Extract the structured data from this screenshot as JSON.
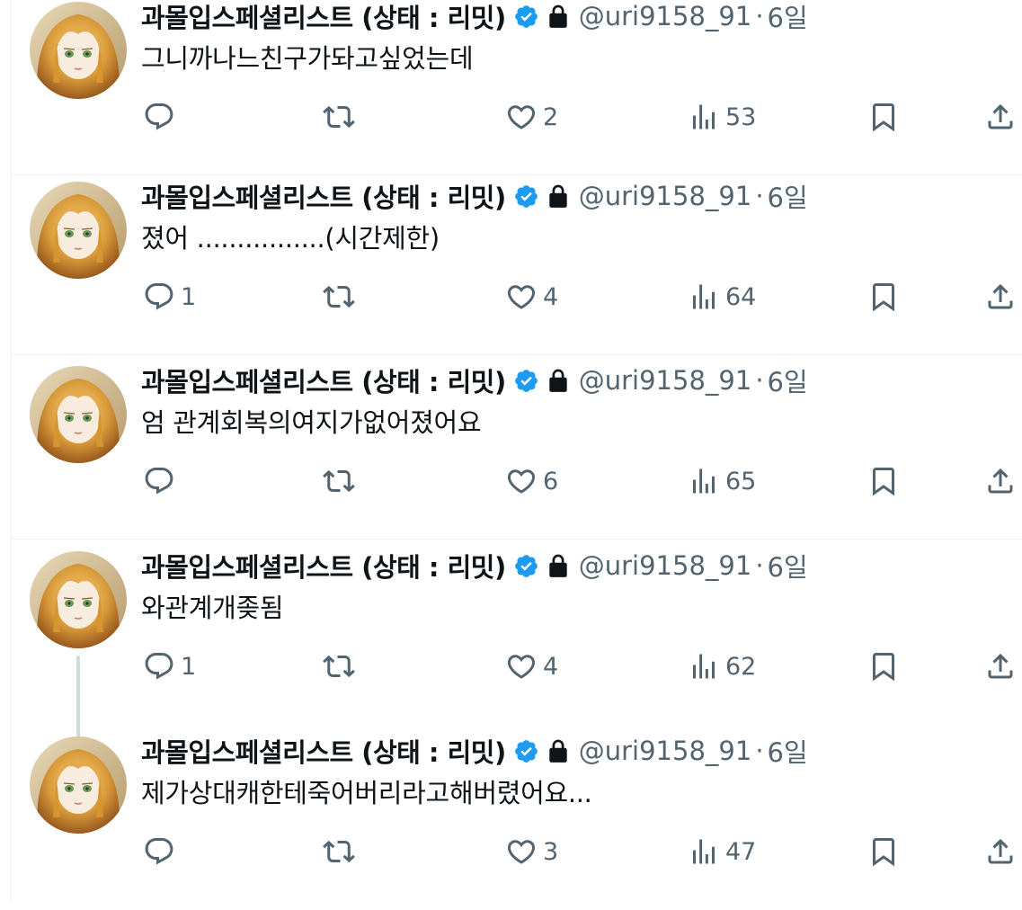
{
  "colors": {
    "verified": "#1d9bf0",
    "text_primary": "#0f1419",
    "text_secondary": "#536471",
    "divider": "#eff3f4",
    "thread_line": "#cfd9de"
  },
  "icons": {
    "reply": "speech-bubble-icon",
    "retweet": "retweet-arrows-icon",
    "like": "heart-icon",
    "views": "bar-chart-icon",
    "bookmark": "bookmark-icon",
    "share": "upload-share-icon",
    "verified": "verified-badge-icon",
    "protected": "lock-icon"
  },
  "tweets": [
    {
      "display_name": "과몰입스페셜리스트 (상태 : 리밋)",
      "handle": "@uri9158_91",
      "separator": "·",
      "time": "6일",
      "text": "그니까나느친구가돠고싶었는데",
      "replies": "",
      "likes": "2",
      "views": "53"
    },
    {
      "display_name": "과몰입스페셜리스트 (상태 : 리밋)",
      "handle": "@uri9158_91",
      "separator": "·",
      "time": "6일",
      "text": "졌어 ................(시간제한)",
      "replies": "1",
      "likes": "4",
      "views": "64"
    },
    {
      "display_name": "과몰입스페셜리스트 (상태 : 리밋)",
      "handle": "@uri9158_91",
      "separator": "·",
      "time": "6일",
      "text": "엄 관계회복의여지가없어졌어요",
      "replies": "",
      "likes": "6",
      "views": "65"
    },
    {
      "display_name": "과몰입스페셜리스트 (상태 : 리밋)",
      "handle": "@uri9158_91",
      "separator": "·",
      "time": "6일",
      "text": "와관계개좆됨",
      "replies": "1",
      "likes": "4",
      "views": "62"
    },
    {
      "display_name": "과몰입스페셜리스트 (상태 : 리밋)",
      "handle": "@uri9158_91",
      "separator": "·",
      "time": "6일",
      "text": "제가상대캐한테죽어버리라고해버렸어요...",
      "replies": "",
      "likes": "3",
      "views": "47"
    }
  ]
}
